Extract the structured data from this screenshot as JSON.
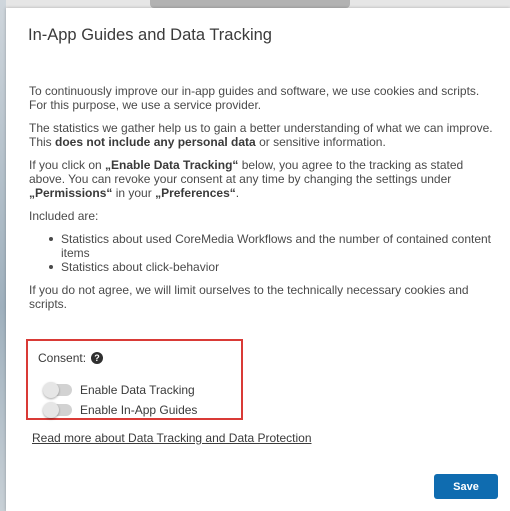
{
  "dialog": {
    "title": "In-App Guides and Data Tracking",
    "para1": "To continuously improve our in-app guides and software, we use cookies and scripts. For this purpose, we use a service provider.",
    "para2_start": "The statistics we gather help us to gain a better understanding of what we can improve. This ",
    "para2_bold": "does not include any personal data",
    "para2_end": " or sensitive information.",
    "para3_a": "If you click on ",
    "para3_bold1": "„Enable Data Tracking“",
    "para3_b": " below, you agree to the tracking as stated above. You can revoke your consent at any time by changing the settings under ",
    "para3_bold2": "„Permissions“",
    "para3_c": " in your ",
    "para3_bold3": "„Preferences“",
    "para3_d": ".",
    "included_label": "Included are:",
    "bullets": [
      "Statistics about used CoreMedia Workflows and the number of contained content items",
      "Statistics about click-behavior"
    ],
    "para4": "If you do not agree, we will limit ourselves to the technically necessary cookies and scripts."
  },
  "consent": {
    "label": "Consent:",
    "help_icon": "?",
    "toggles": [
      {
        "label": "Enable Data Tracking",
        "on": false
      },
      {
        "label": "Enable In-App Guides",
        "on": false
      }
    ]
  },
  "read_more": "Read more about Data Tracking and Data Protection",
  "save_label": "Save",
  "colors": {
    "accent": "#0f6cb0",
    "highlight_border": "#d93a36"
  }
}
